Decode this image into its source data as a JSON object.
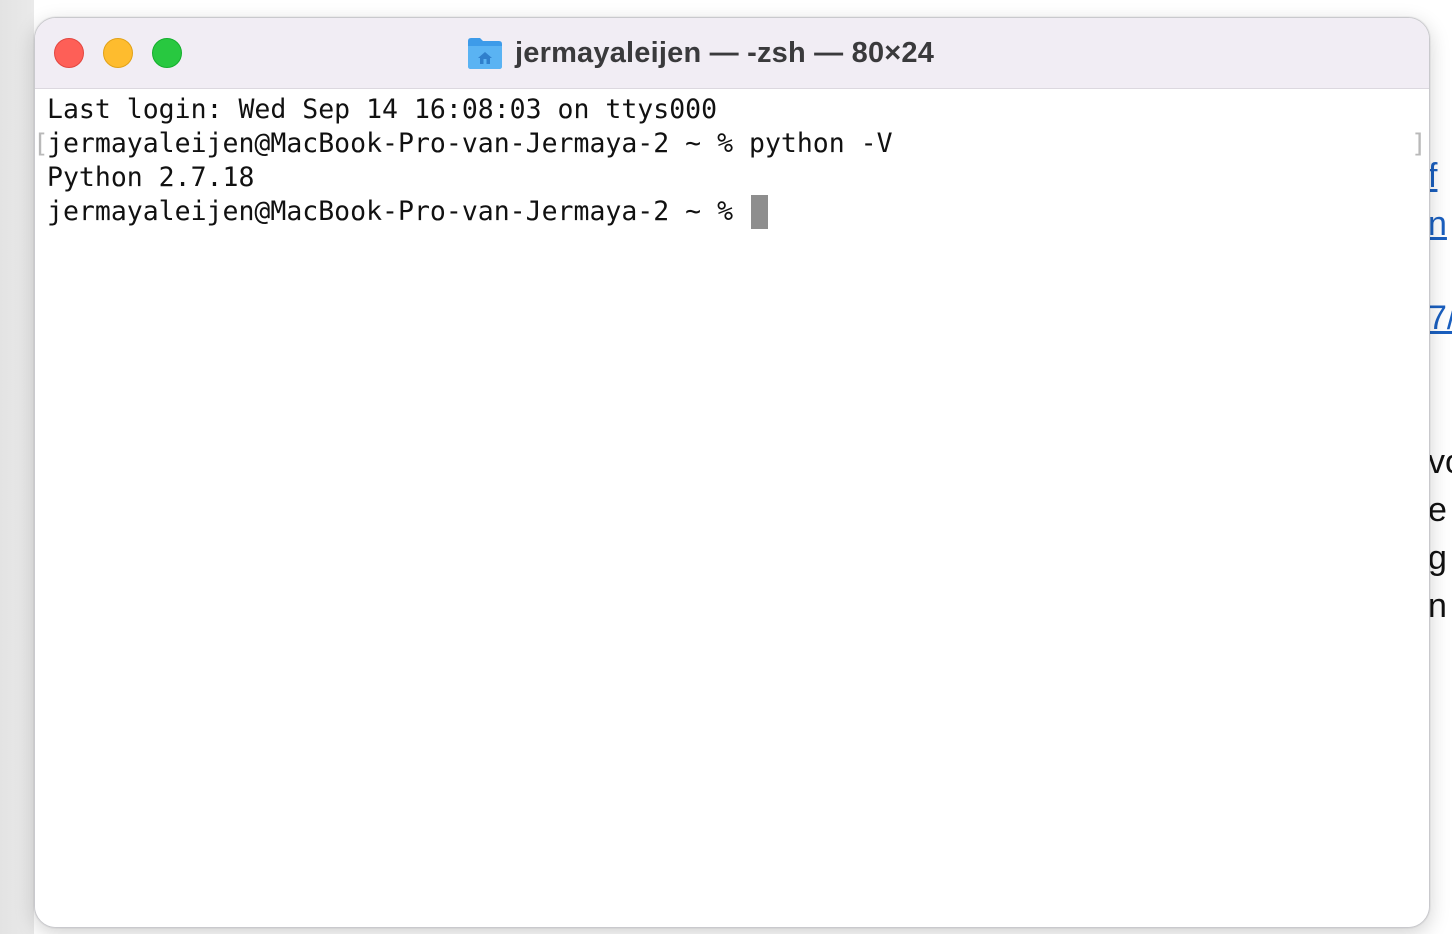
{
  "window": {
    "title": "jermayaleijen — -zsh — 80×24",
    "title_icon": "home-folder-icon",
    "traffic_lights": {
      "close": "#fe5f57",
      "minimize": "#febc2e",
      "zoom": "#28c840"
    }
  },
  "terminal": {
    "lines": [
      "Last login: Wed Sep 14 16:08:03 on ttys000",
      "jermayaleijen@MacBook-Pro-van-Jermaya-2 ~ % python -V",
      "Python 2.7.18",
      "jermayaleijen@MacBook-Pro-van-Jermaya-2 ~ % "
    ],
    "cursor_color": "#8e8e8e"
  },
  "background_doc": {
    "fragments": [
      "f",
      "n",
      "7/",
      "vo",
      "e",
      "g",
      "n"
    ]
  }
}
